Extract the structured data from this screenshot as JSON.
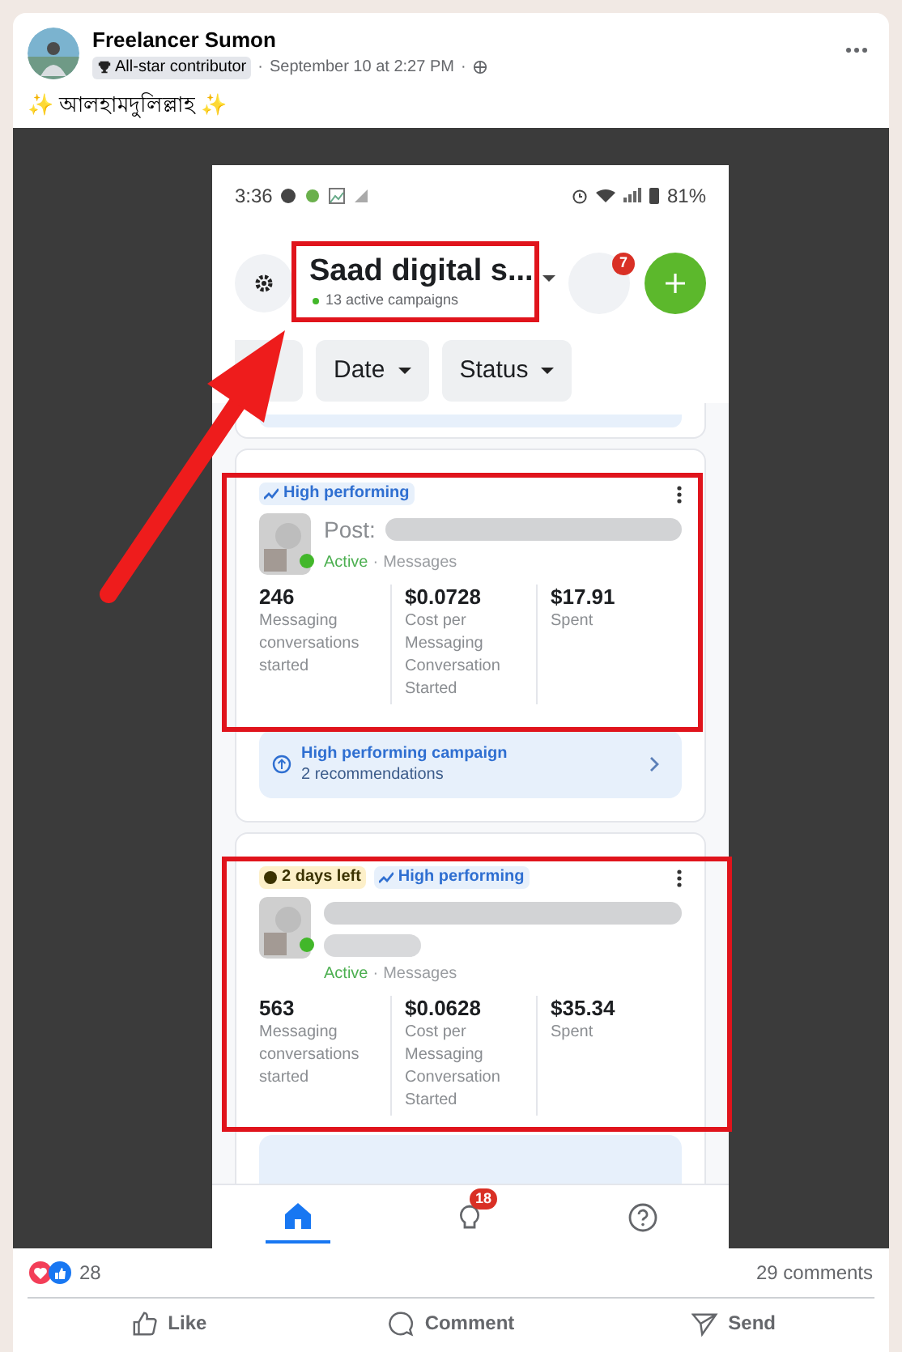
{
  "post": {
    "author": "Freelancer Sumon",
    "badge": "All-star contributor",
    "time": "September 10 at 2:27 PM",
    "separator": "·",
    "text": "✨ আলহামদুলিল্লাহ ✨"
  },
  "phone": {
    "status_time": "3:36",
    "battery": "81%",
    "account": {
      "name": "Saad digital s...",
      "subtitle": "13 active campaigns"
    },
    "notification_count": "7",
    "filters": [
      "Date",
      "Status"
    ],
    "campaigns": [
      {
        "tags": [
          {
            "kind": "performance",
            "label": "High performing"
          }
        ],
        "post_label": "Post:",
        "status": "Active",
        "separator": "·",
        "objective": "Messages",
        "metrics": [
          {
            "value": "246",
            "label": "Messaging conversations started"
          },
          {
            "value": "$0.0728",
            "label": "Cost per Messaging Conversation Started"
          },
          {
            "value": "$17.91",
            "label": "Spent"
          }
        ],
        "recommendation": {
          "title": "High performing campaign",
          "subtitle": "2 recommendations"
        }
      },
      {
        "tags": [
          {
            "kind": "time",
            "label": "2 days left"
          },
          {
            "kind": "performance",
            "label": "High performing"
          }
        ],
        "status": "Active",
        "separator": "·",
        "objective": "Messages",
        "metrics": [
          {
            "value": "563",
            "label": "Messaging conversations started"
          },
          {
            "value": "$0.0628",
            "label": "Cost per Messaging Conversation Started"
          },
          {
            "value": "$35.34",
            "label": "Spent"
          }
        ]
      }
    ],
    "nav": [
      {
        "kind": "home",
        "selected": true
      },
      {
        "kind": "ideas",
        "selected": false,
        "badge": "18"
      },
      {
        "kind": "help",
        "selected": false
      }
    ]
  },
  "reactions": {
    "count": "28",
    "comments": "29 comments"
  },
  "actions": [
    {
      "kind": "like",
      "label": "Like"
    },
    {
      "kind": "comment",
      "label": "Comment"
    },
    {
      "kind": "send",
      "label": "Send"
    }
  ]
}
